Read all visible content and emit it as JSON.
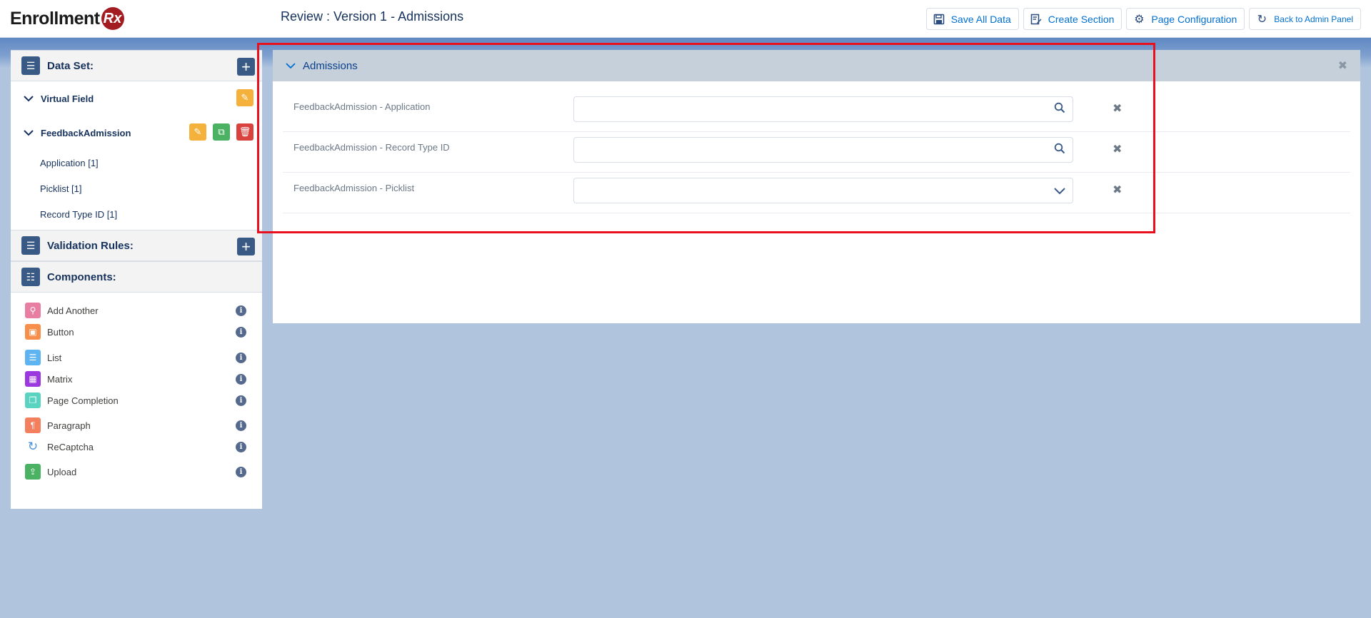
{
  "header": {
    "logo_text": "Enrollment",
    "logo_badge": "Rx",
    "page_title": "Review : Version 1 - Admissions",
    "actions": [
      {
        "label": "Save All Data",
        "icon": "save-icon"
      },
      {
        "label": "Create Section",
        "icon": "edit-section-icon"
      },
      {
        "label": "Page Configuration",
        "icon": "gear-icon"
      },
      {
        "label": "Back to Admin Panel",
        "icon": "refresh-back-icon"
      }
    ]
  },
  "sidebar": {
    "data_set": {
      "title": "Data Set:",
      "items": [
        {
          "label": "Virtual Field",
          "children": []
        },
        {
          "label": "FeedbackAdmission",
          "children": [
            "Application [1]",
            "Picklist [1]",
            "Record Type ID [1]"
          ]
        }
      ]
    },
    "validation_rules": {
      "title": "Validation Rules:"
    },
    "components": {
      "title": "Components:",
      "items": [
        {
          "label": "Add Another",
          "color": "#e87fa3",
          "icon": "person-add-icon"
        },
        {
          "label": "Button",
          "color": "#f78f4a",
          "icon": "button-grid-icon"
        },
        {
          "label": "List",
          "color": "#5eb4f1",
          "icon": "list-icon"
        },
        {
          "label": "Matrix",
          "color": "#9b38e0",
          "icon": "matrix-icon"
        },
        {
          "label": "Page Completion",
          "color": "#5ad3c1",
          "icon": "page-icon"
        },
        {
          "label": "Paragraph",
          "color": "#f47f5e",
          "icon": "paragraph-icon"
        },
        {
          "label": "ReCaptcha",
          "color": "#4a90e2",
          "icon": "recaptcha-icon"
        },
        {
          "label": "Upload",
          "color": "#4bb263",
          "icon": "upload-icon"
        }
      ]
    }
  },
  "main": {
    "section_title": "Admissions",
    "fields": [
      {
        "label": "FeedbackAdmission - Application",
        "type": "lookup",
        "value": ""
      },
      {
        "label": "FeedbackAdmission - Record Type ID",
        "type": "lookup",
        "value": ""
      },
      {
        "label": "FeedbackAdmission - Picklist",
        "type": "picklist",
        "value": ""
      }
    ]
  }
}
